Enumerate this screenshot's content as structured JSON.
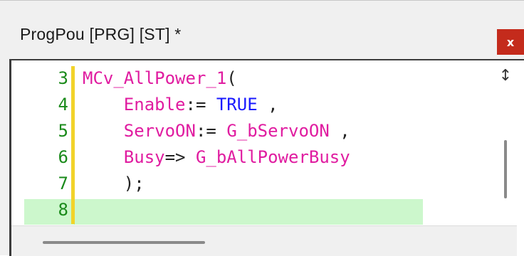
{
  "window": {
    "title": "ProgPou [PRG] [ST] *",
    "close_label": "x",
    "accent_close": "#c42b1c"
  },
  "editor": {
    "lines": [
      {
        "number": "3",
        "tokens": [
          {
            "text": "MCv_AllPower_1",
            "kind": "id"
          },
          {
            "text": "(",
            "kind": "pn"
          }
        ]
      },
      {
        "number": "4",
        "tokens": [
          {
            "text": "    Enable",
            "kind": "id"
          },
          {
            "text": ":= ",
            "kind": "pn"
          },
          {
            "text": "TRUE",
            "kind": "kw"
          },
          {
            "text": " ,",
            "kind": "pn"
          }
        ]
      },
      {
        "number": "5",
        "tokens": [
          {
            "text": "    ServoON",
            "kind": "id"
          },
          {
            "text": ":= ",
            "kind": "pn"
          },
          {
            "text": "G_bServoON",
            "kind": "id"
          },
          {
            "text": " ,",
            "kind": "pn"
          }
        ]
      },
      {
        "number": "6",
        "tokens": [
          {
            "text": "    Busy",
            "kind": "id"
          },
          {
            "text": "=> ",
            "kind": "pn"
          },
          {
            "text": "G_bAllPowerBusy",
            "kind": "id"
          }
        ]
      },
      {
        "number": "7",
        "tokens": [
          {
            "text": "    );",
            "kind": "pn"
          }
        ]
      },
      {
        "number": "8",
        "tokens": []
      }
    ],
    "current_line": "8",
    "colors": {
      "line_number": "#1a8a1a",
      "identifier": "#e01ca0",
      "keyword": "#1a1aff",
      "punctuation": "#222222",
      "current_line_bg": "#ccf7cc",
      "change_bar": "#f2d32a"
    },
    "split_icon": "split-view-icon"
  }
}
